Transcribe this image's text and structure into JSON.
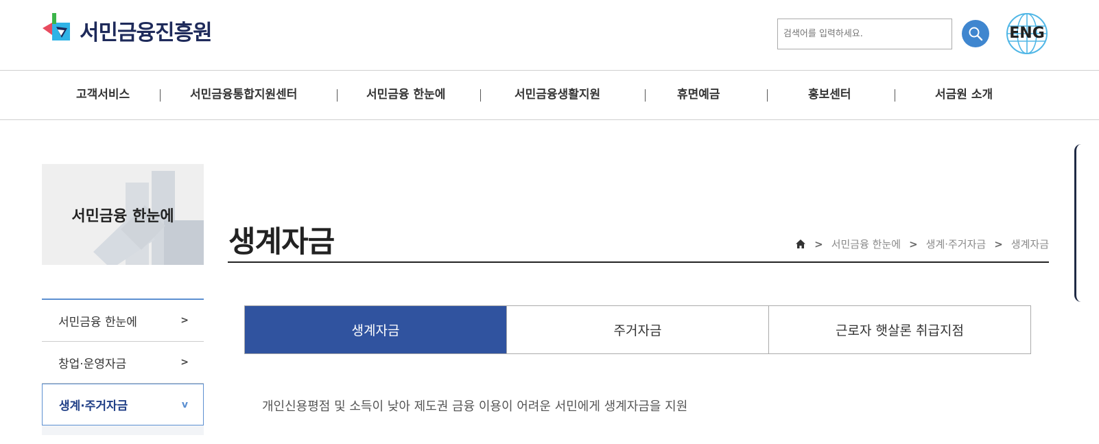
{
  "header": {
    "logo_text": "서민금융진흥원",
    "search_placeholder": "검색어를 입력하세요.",
    "eng_label": "ENG"
  },
  "nav": {
    "items": [
      {
        "label": "고객서비스"
      },
      {
        "label": "서민금융통합지원센터"
      },
      {
        "label": "서민금융 한눈에"
      },
      {
        "label": "서민금융생활지원"
      },
      {
        "label": "휴면예금"
      },
      {
        "label": "홍보센터"
      },
      {
        "label": "서금원 소개"
      }
    ]
  },
  "sidebar": {
    "title": "서민금융 한눈에",
    "items": [
      {
        "label": "서민금융 한눈에",
        "arrow": ">"
      },
      {
        "label": "창업·운영자금",
        "arrow": ">"
      },
      {
        "label": "생계·주거자금",
        "arrow": "v"
      }
    ]
  },
  "main": {
    "title": "생계자금",
    "breadcrumb": {
      "sep": ">",
      "items": [
        "서민금융 한눈에",
        "생계·주거자금",
        "생계자금"
      ]
    },
    "tabs": [
      {
        "label": "생계자금",
        "active": true
      },
      {
        "label": "주거자금",
        "active": false
      },
      {
        "label": "근로자 햇살론 취급지점",
        "active": false
      }
    ],
    "description": "개인신용평점 및 소득이 낮아 제도권 금융 이용이 어려운 서민에게 생계자금을 지원"
  },
  "colors": {
    "active_tab": "#30539f",
    "search_button": "#3f86cf",
    "sidebar_accent": "#5b8fd1"
  }
}
